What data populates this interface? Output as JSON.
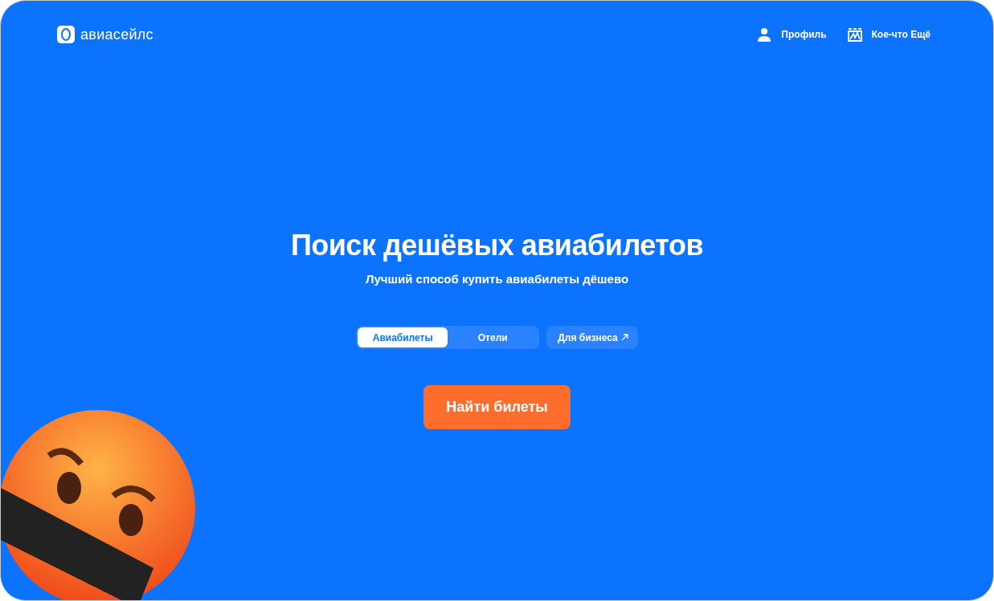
{
  "header": {
    "logo_text": "авиасейлс",
    "nav": [
      {
        "label": "Профиль",
        "kind": "profile"
      },
      {
        "label": "Кое-что Ещё",
        "kind": "more"
      }
    ]
  },
  "hero": {
    "title": "Поиск дешёвых авиабилетов",
    "subtitle": "Лучший способ купить авиабилеты дёшево"
  },
  "tabs": [
    {
      "label": "Авиабилеты",
      "selected": true
    },
    {
      "label": "Отели",
      "selected": false
    }
  ],
  "business_link": {
    "label": "Для бизнеса"
  },
  "search_button": {
    "label": "Найти билеты"
  }
}
